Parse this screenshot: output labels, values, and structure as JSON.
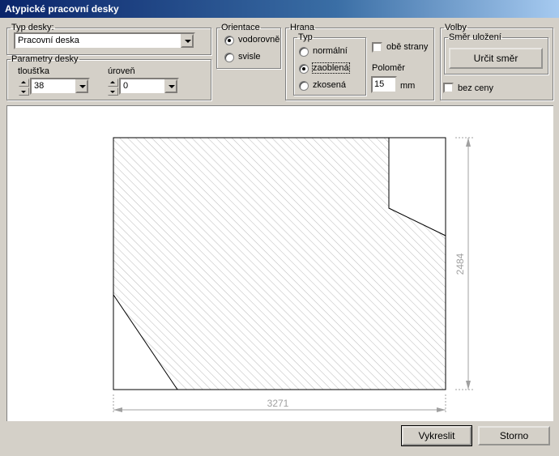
{
  "window": {
    "title": "Atypické pracovní desky"
  },
  "typ_desky": {
    "legend": "Typ desky:",
    "selected": "Pracovní deska"
  },
  "parametry": {
    "legend": "Parametry desky",
    "tloustka_label": "tloušťka",
    "tloustka_value": "38",
    "uroven_label": "úroveň",
    "uroven_value": "0"
  },
  "orientace": {
    "legend": "Orientace",
    "options": [
      "vodorovně",
      "svisle"
    ],
    "selected": "vodorovně"
  },
  "hrana": {
    "legend": "Hrana",
    "typ_legend": "Typ",
    "typ_options": [
      "normální",
      "zaoblená",
      "zkosená"
    ],
    "selected": "zaoblená",
    "obe_strany_label": "obě strany",
    "polomer_label": "Poloměr",
    "polomer_value": "15",
    "unit": "mm"
  },
  "volby": {
    "legend": "Volby",
    "smer_legend": "Směr uložení",
    "urcit_smer_label": "Určit směr",
    "bez_ceny_label": "bez ceny"
  },
  "drawing": {
    "width_dim": "3271",
    "height_dim": "2484"
  },
  "buttons": {
    "vykreslit": "Vykreslit",
    "storno": "Storno"
  },
  "colors": {
    "title_start": "#0a246a",
    "title_end": "#a6caf0",
    "dimension": "#a0a0a0",
    "face": "#d4d0c8"
  }
}
